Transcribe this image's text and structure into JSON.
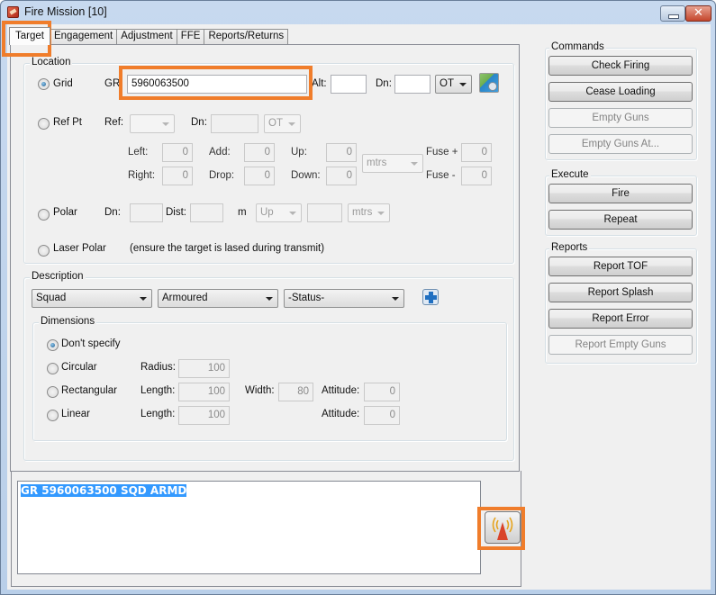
{
  "window": {
    "title": "Fire Mission [10]",
    "minimize_label": "",
    "close_label": "✕"
  },
  "tabs": [
    {
      "label": "Target",
      "active": true
    },
    {
      "label": "Engagement",
      "active": false
    },
    {
      "label": "Adjustment",
      "active": false
    },
    {
      "label": "FFE",
      "active": false
    },
    {
      "label": "Reports/Returns",
      "active": false
    }
  ],
  "location": {
    "group_label": "Location",
    "grid": {
      "label": "Grid",
      "selected": true,
      "gr_label": "GR:",
      "gr_value": "5960063500",
      "alt_label": "Alt:",
      "alt_value": "",
      "dn_label": "Dn:",
      "dn_value": "",
      "ot_value": "OT",
      "map_icon": "map-icon"
    },
    "ref_pt": {
      "label": "Ref Pt",
      "selected": false,
      "ref_label": "Ref:",
      "ref_value": "",
      "dn_label": "Dn:",
      "dn_value": "",
      "ot_value": "OT",
      "left_label": "Left:",
      "left_value": "0",
      "right_label": "Right:",
      "right_value": "0",
      "add_label": "Add:",
      "add_value": "0",
      "drop_label": "Drop:",
      "drop_value": "0",
      "up_label": "Up:",
      "up_value": "0",
      "down_label": "Down:",
      "down_value": "0",
      "units_value": "mtrs",
      "fuse_plus_label": "Fuse +",
      "fuse_plus_value": "0",
      "fuse_minus_label": "Fuse -",
      "fuse_minus_value": "0"
    },
    "polar": {
      "label": "Polar",
      "selected": false,
      "dn_label": "Dn:",
      "dn_value": "",
      "dist_label": "Dist:",
      "dist_value": "",
      "m_label": "m",
      "updown_value": "Up",
      "vert_value": "",
      "units_value": "mtrs"
    },
    "laser_polar": {
      "label": "Laser Polar",
      "selected": false,
      "note": "(ensure the target is lased during transmit)"
    }
  },
  "description": {
    "group_label": "Description",
    "size_value": "Squad",
    "type_value": "Armoured",
    "status_value": "-Status-",
    "add_icon": "plus-icon",
    "dimensions": {
      "group_label": "Dimensions",
      "dont_specify": {
        "label": "Don't specify",
        "selected": true
      },
      "circular": {
        "label": "Circular",
        "selected": false,
        "radius_label": "Radius:",
        "radius_value": "100"
      },
      "rectangular": {
        "label": "Rectangular",
        "selected": false,
        "length_label": "Length:",
        "length_value": "100",
        "width_label": "Width:",
        "width_value": "80",
        "attitude_label": "Attitude:",
        "attitude_value": "0"
      },
      "linear": {
        "label": "Linear",
        "selected": false,
        "length_label": "Length:",
        "length_value": "100",
        "attitude_label": "Attitude:",
        "attitude_value": "0"
      }
    }
  },
  "commands": {
    "group_label": "Commands",
    "buttons": [
      {
        "label": "Check Firing",
        "enabled": true
      },
      {
        "label": "Cease Loading",
        "enabled": true
      },
      {
        "label": "Empty Guns",
        "enabled": false
      },
      {
        "label": "Empty Guns At...",
        "enabled": false
      }
    ]
  },
  "execute": {
    "group_label": "Execute",
    "buttons": [
      {
        "label": "Fire",
        "enabled": true
      },
      {
        "label": "Repeat",
        "enabled": true
      }
    ]
  },
  "reports": {
    "group_label": "Reports",
    "buttons": [
      {
        "label": "Report TOF",
        "enabled": true
      },
      {
        "label": "Report Splash",
        "enabled": true
      },
      {
        "label": "Report Error",
        "enabled": true
      },
      {
        "label": "Report Empty Guns",
        "enabled": false
      }
    ]
  },
  "message": {
    "text": "GR 5960063500 SQD ARMD",
    "transmit_icon": "transmit-icon"
  },
  "colors": {
    "highlight": "#f07d2b",
    "selection": "#3399ff"
  }
}
